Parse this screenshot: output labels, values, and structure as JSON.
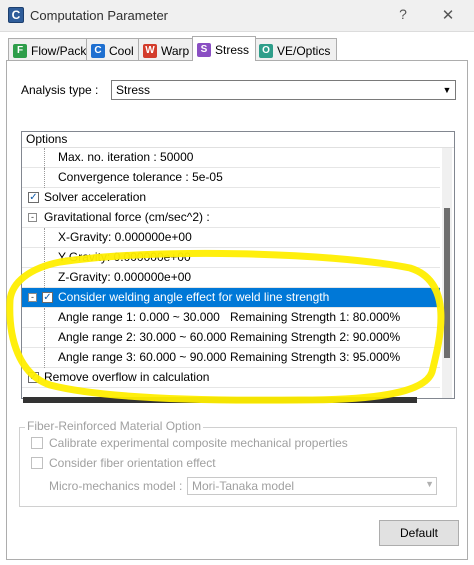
{
  "window": {
    "title": "Computation Parameter",
    "help": "?",
    "close": "✕",
    "icon_letter": "C"
  },
  "tabs": [
    {
      "icon": "F",
      "label": "Flow/Pack",
      "color": "#2e9e4a"
    },
    {
      "icon": "C",
      "label": "Cool",
      "color": "#1e6fd0"
    },
    {
      "icon": "W",
      "label": "Warp",
      "color": "#d33c2c"
    },
    {
      "icon": "S",
      "label": "Stress",
      "color": "#8a4fc3"
    },
    {
      "icon": "O",
      "label": "VE/Optics",
      "color": "#2e9e8a"
    }
  ],
  "analysis": {
    "label": "Analysis type :",
    "value": "Stress"
  },
  "options": {
    "header": "Options",
    "rows": [
      {
        "text": "Max. no. iteration : 50000"
      },
      {
        "text": "Convergence tolerance : 5e-05"
      },
      {
        "text": "Solver acceleration"
      },
      {
        "text": "Gravitational force (cm/sec^2) :"
      },
      {
        "text": "X-Gravity: 0.000000e+00"
      },
      {
        "text": "Y-Gravity: 0.000000e+00"
      },
      {
        "text": "Z-Gravity: 0.000000e+00"
      },
      {
        "text": "Consider welding angle effect for weld line strength"
      },
      {
        "text": "Angle range 1:   0.000 ~ 30.000",
        "strength": "Remaining Strength 1: 80.000%"
      },
      {
        "text": "Angle range 2: 30.000 ~ 60.000",
        "strength": "Remaining Strength 2: 90.000%"
      },
      {
        "text": "Angle range 3: 60.000 ~ 90.000",
        "strength": "Remaining Strength 3: 95.000%"
      },
      {
        "text": "Remove overflow in calculation"
      }
    ]
  },
  "fiber": {
    "legend": "Fiber-Reinforced Material Option",
    "opt1": "Calibrate experimental composite mechanical properties",
    "opt2": "Consider fiber orientation effect",
    "model_label": "Micro-mechanics model :",
    "model_value": "Mori-Tanaka model"
  },
  "buttons": {
    "default": "Default"
  },
  "colors": {
    "highlight": "#ffff00",
    "selection": "#0078d7"
  }
}
